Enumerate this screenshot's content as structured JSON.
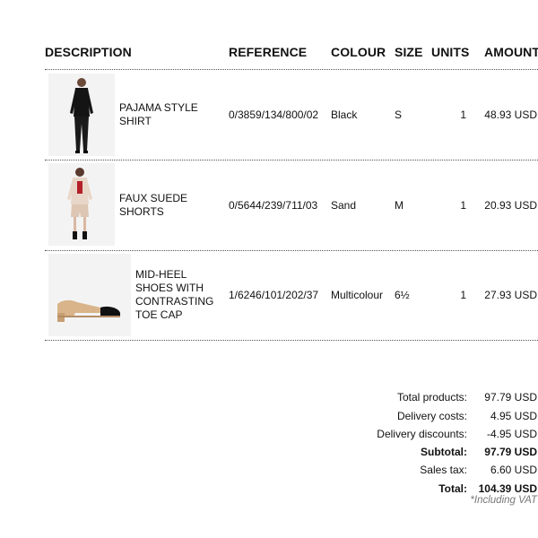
{
  "table": {
    "headers": {
      "description": "DESCRIPTION",
      "reference": "REFERENCE",
      "colour": "COLOUR",
      "size": "SIZE",
      "units": "UNITS",
      "amount": "AMOUNT"
    },
    "rows": [
      {
        "image_icon": "model-in-black-pajama-shirt-image",
        "description": [
          "PAJAMA STYLE",
          "SHIRT"
        ],
        "reference": "0/3859/134/800/02",
        "colour": "Black",
        "size": "S",
        "units": "1",
        "amount": "48.93 USD"
      },
      {
        "image_icon": "model-in-faux-suede-shorts-image",
        "description": [
          "FAUX SUEDE",
          "SHORTS"
        ],
        "reference": "0/5644/239/711/03",
        "colour": "Sand",
        "size": "M",
        "units": "1",
        "amount": "20.93 USD"
      },
      {
        "image_icon": "mid-heel-shoe-image",
        "description": [
          "MID-HEEL",
          "SHOES WITH",
          "CONTRASTING",
          "TOE CAP"
        ],
        "reference": "1/6246/101/202/37",
        "colour": "Multicolour",
        "size": "6½",
        "units": "1",
        "amount": "27.93 USD"
      }
    ]
  },
  "totals": {
    "total_products_label": "Total products:",
    "total_products_value": "97.79 USD",
    "delivery_costs_label": "Delivery costs:",
    "delivery_costs_value": "4.95 USD",
    "delivery_discounts_label": "Delivery discounts:",
    "delivery_discounts_value": "-4.95 USD",
    "subtotal_label": "Subtotal:",
    "subtotal_value": "97.79 USD",
    "sales_tax_label": "Sales tax:",
    "sales_tax_value": "6.60 USD",
    "total_label": "Total:",
    "total_value": "104.39 USD",
    "vat_note": "*Including VAT"
  },
  "colors": {
    "text": "#111111",
    "rule": "#555555",
    "note": "#777777"
  }
}
